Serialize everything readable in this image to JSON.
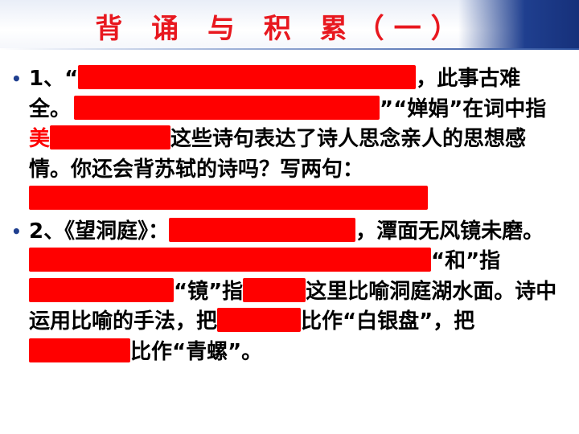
{
  "title": "背 诵 与 积 累（一）",
  "item1": {
    "bullet": "•",
    "p1": "1、“",
    "p2": "，此事古难全。",
    "p3": "”“婵娟”在词中指",
    "p4": "美",
    "p5": "这些诗句表达了诗人思念亲人的思想感情。你还会背苏轼的诗吗？写两句："
  },
  "item2": {
    "bullet": "•",
    "p1": "2、《望洞庭》：",
    "p2": "，潭面无风镜未磨。",
    "p3": "“和”指",
    "p4": "“镜”指",
    "p5": "这里比喻洞庭湖水面。诗中运用比喻的手法，把",
    "p6": "比作“白银盘”，把",
    "p7": "比作“青螺”。"
  },
  "colors": {
    "title": "#e8181f",
    "mask": "#ff0000",
    "header_accent": "#1f3f8f"
  }
}
